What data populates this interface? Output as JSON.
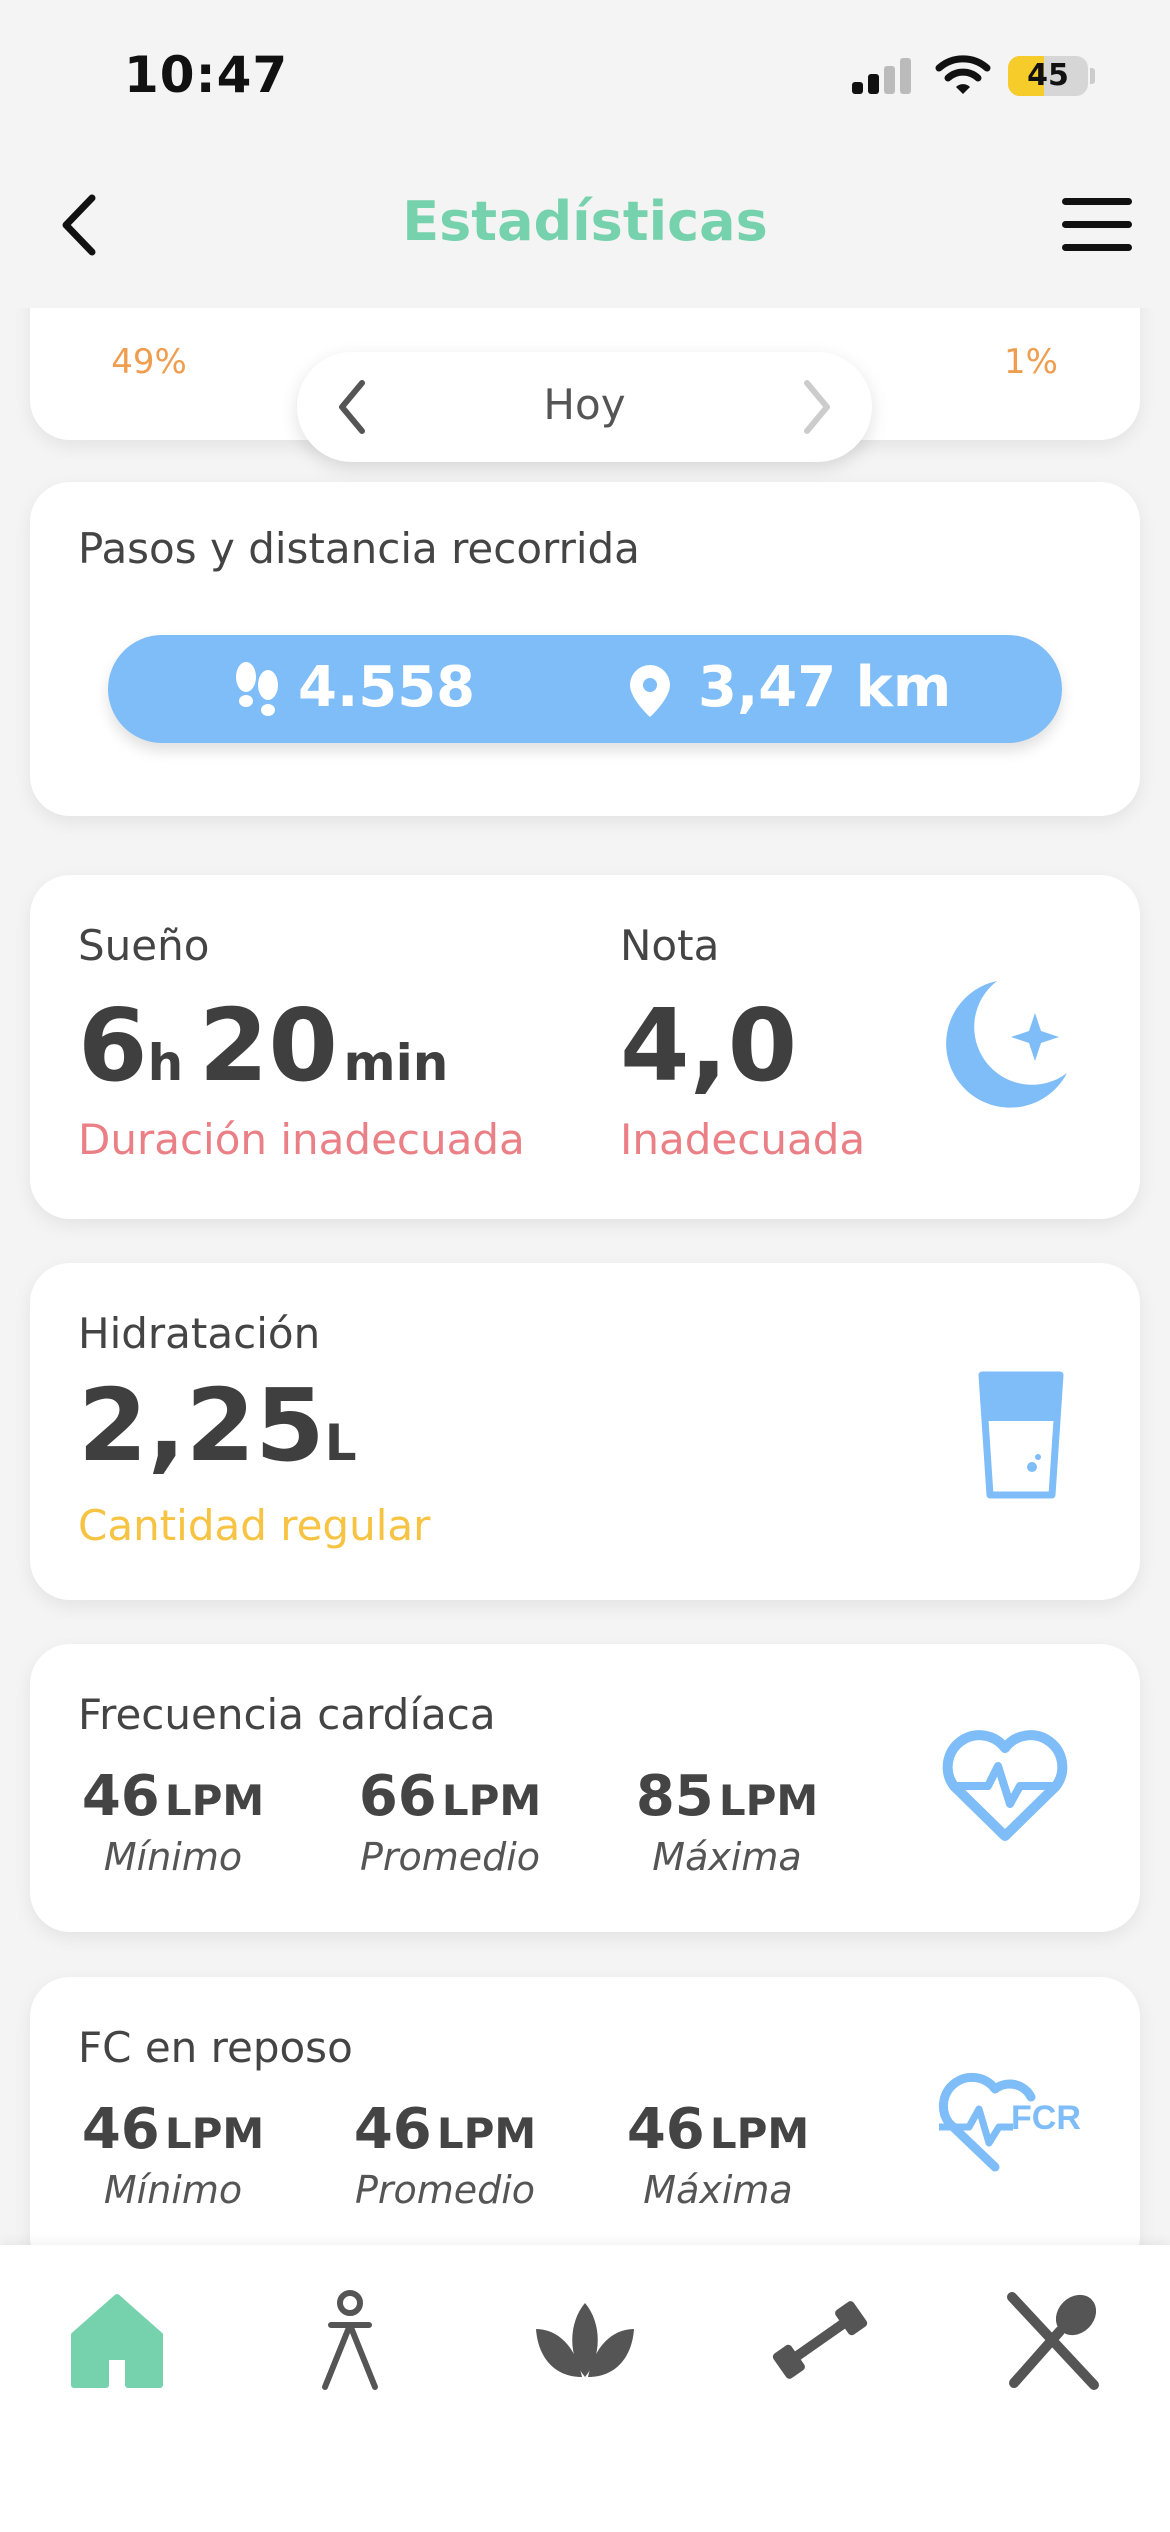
{
  "status_bar": {
    "time": "10:47",
    "battery": "45"
  },
  "nav": {
    "title": "Estadísticas"
  },
  "rings": {
    "percents": [
      "49%",
      "1%"
    ]
  },
  "date_selector": {
    "label": "Hoy"
  },
  "steps": {
    "label": "Pasos y distancia recorrida",
    "steps": "4.558",
    "distance": "3,47 km"
  },
  "sleep": {
    "label": "Sueño",
    "hours": "6",
    "hours_unit": "h",
    "minutes": "20",
    "minutes_unit": "min",
    "duration_status": "Duración inadecuada",
    "score_label": "Nota",
    "score": "4,0",
    "score_status": "Inadecuada"
  },
  "hydration": {
    "label": "Hidratación",
    "value": "2,25",
    "unit": "L",
    "status": "Cantidad regular"
  },
  "heart_rate": {
    "label": "Frecuencia cardíaca",
    "unit": "LPM",
    "min": {
      "value": "46",
      "label": "Mínimo"
    },
    "avg": {
      "value": "66",
      "label": "Promedio"
    },
    "max": {
      "value": "85",
      "label": "Máxima"
    }
  },
  "resting_hr": {
    "label": "FC en reposo",
    "unit": "LPM",
    "badge": "FCR",
    "min": {
      "value": "46",
      "label": "Mínimo"
    },
    "avg": {
      "value": "46",
      "label": "Promedio"
    },
    "max": {
      "value": "46",
      "label": "Máxima"
    }
  },
  "tabbar": {
    "items": [
      "home-icon",
      "person-icon",
      "lotus-icon",
      "dumbbell-icon",
      "fork-spoon-icon"
    ],
    "active_color": "#76d1ad"
  },
  "colors": {
    "accent": "#76d1ad",
    "blue": "#7ebdf7",
    "red": "#ea7f86",
    "yellow": "#f6c342",
    "orange": "#ef9d4f"
  }
}
